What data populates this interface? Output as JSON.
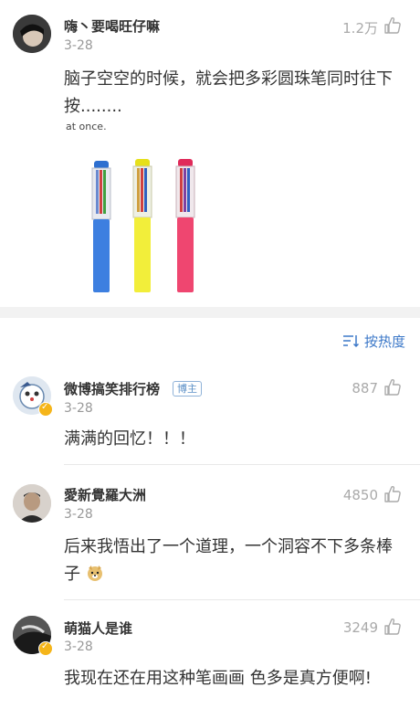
{
  "post_comment": {
    "username": "嗨丶要喝旺仔嘛",
    "date": "3-28",
    "likes": "1.2万",
    "text": "脑子空空的时候，就会把多彩圆珠笔同时往下按........",
    "image_caption": "at once.",
    "pens": [
      {
        "cap_color": "#2d6fd0",
        "body_color": "#3d7fe0"
      },
      {
        "cap_color": "#e6e01a",
        "body_color": "#f2ee3a"
      },
      {
        "cap_color": "#e02a5a",
        "body_color": "#ef4670"
      }
    ]
  },
  "sort": {
    "icon": "sort-icon",
    "label": "按热度"
  },
  "comments": [
    {
      "username": "微博搞笑排行榜",
      "badge": "博主",
      "date": "3-28",
      "likes": "887",
      "text": "满满的回忆！！！"
    },
    {
      "username": "愛新覺羅大洲",
      "date": "3-28",
      "likes": "4850",
      "text": "后来我悟出了一个道理，一个洞容不下多条棒子"
    },
    {
      "username": "萌猫人是谁",
      "date": "3-28",
      "likes": "3249",
      "text": "我现在还在用这种笔画画 色多是真方便啊!"
    }
  ],
  "colors": {
    "accent": "#3c78c8",
    "muted": "#999999",
    "separator_band": "#f2f2f2"
  }
}
